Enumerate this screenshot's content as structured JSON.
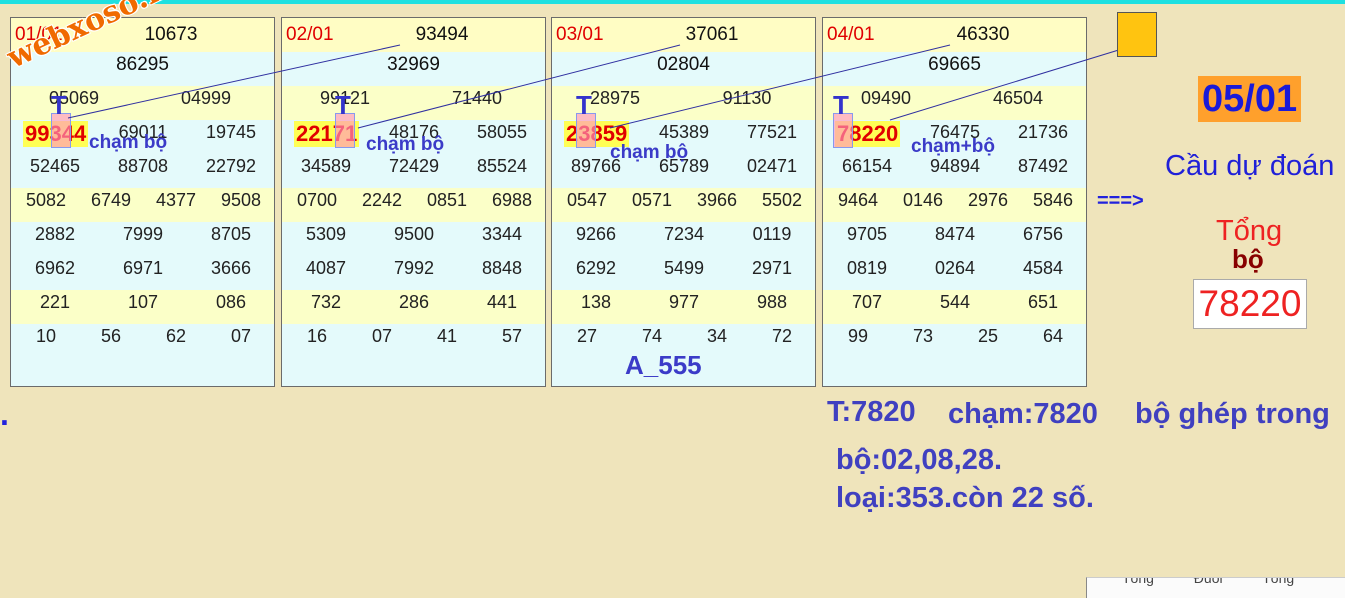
{
  "watermark": "webxoso.net",
  "panels": [
    {
      "date": "01/01",
      "top": "10673",
      "g1": "86295",
      "g2": [
        "05069",
        "04999"
      ],
      "g3": [
        "99344",
        "69011",
        "19745",
        "52465",
        "88708",
        "22792"
      ],
      "g4": [
        "5082",
        "6749",
        "4377",
        "9508"
      ],
      "g5": [
        "2882",
        "7999",
        "8705",
        "6962",
        "6971",
        "3666"
      ],
      "g6": [
        "221",
        "107",
        "086"
      ],
      "g7": [
        "10",
        "56",
        "62",
        "07"
      ],
      "note": "chạm bộ",
      "tick": "T"
    },
    {
      "date": "02/01",
      "top": "93494",
      "g1": "32969",
      "g2": [
        "99121",
        "71440"
      ],
      "g3": [
        "22171",
        "48176",
        "58055",
        "34589",
        "72429",
        "85524"
      ],
      "g4": [
        "0700",
        "2242",
        "0851",
        "6988"
      ],
      "g5": [
        "5309",
        "9500",
        "3344",
        "4087",
        "7992",
        "8848"
      ],
      "g6": [
        "732",
        "286",
        "441"
      ],
      "g7": [
        "16",
        "07",
        "41",
        "57"
      ],
      "note": "chạm bộ",
      "tick": "T"
    },
    {
      "date": "03/01",
      "top": "37061",
      "g1": "02804",
      "g2": [
        "28975",
        "91130"
      ],
      "g3": [
        "23859",
        "45389",
        "77521",
        "89766",
        "65789",
        "02471"
      ],
      "g4": [
        "0547",
        "0571",
        "3966",
        "5502"
      ],
      "g5": [
        "9266",
        "7234",
        "0119",
        "6292",
        "5499",
        "2971"
      ],
      "g6": [
        "138",
        "977",
        "988"
      ],
      "g7": [
        "27",
        "74",
        "34",
        "72"
      ],
      "note": "chạm bộ",
      "tick": "T",
      "footer": "A_555"
    },
    {
      "date": "04/01",
      "top": "46330",
      "g1": "69665",
      "g2": [
        "09490",
        "46504"
      ],
      "g3": [
        "78220",
        "76475",
        "21736",
        "66154",
        "94894",
        "87492"
      ],
      "g4": [
        "9464",
        "0146",
        "2976",
        "5846"
      ],
      "g5": [
        "9705",
        "8474",
        "6756",
        "0819",
        "0264",
        "4584"
      ],
      "g6": [
        "707",
        "544",
        "651"
      ],
      "g7": [
        "99",
        "73",
        "25",
        "64"
      ],
      "note": "chạm+bộ",
      "tick": "T"
    }
  ],
  "arrow": "===>",
  "side": {
    "date": "05/01",
    "title": "Cầu dự đoán",
    "sum": "Tổng",
    "bo": "bộ",
    "value": "78220"
  },
  "dot": ".",
  "result": {
    "line1a": "T:7820",
    "line1b": "chạm:7820",
    "line1c": "bộ ghép trong",
    "line2": "bộ:02,08,28.",
    "line3": "loại:353.còn 22 số."
  },
  "bottom_hint": "Tổng Đuôi Tổng",
  "colors": {
    "accent": "#1ee0e0",
    "number_red": "#e00000",
    "annotation_blue": "#3b3bc8",
    "panel_bg": "#e4fafb",
    "header_bg": "#fffdc4"
  }
}
